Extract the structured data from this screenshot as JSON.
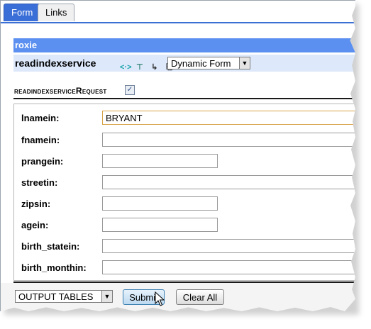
{
  "tabs": [
    {
      "label": "Form",
      "active": true
    },
    {
      "label": "Links",
      "active": false
    }
  ],
  "header": {
    "title": "roxie",
    "service": "readindexservice",
    "service_icons": [
      "xml-view-icon",
      "tree-icon",
      "link-icon",
      "flow-icon"
    ],
    "form_type": {
      "selected": "Dynamic Form"
    }
  },
  "request": {
    "label": "readindexserviceRequest",
    "checked": true
  },
  "fields": [
    {
      "label": "lnamein:",
      "value": "BRYANT",
      "width": "full"
    },
    {
      "label": "fnamein:",
      "value": "",
      "width": "full"
    },
    {
      "label": "prangein:",
      "value": "",
      "width": "short"
    },
    {
      "label": "streetin:",
      "value": "",
      "width": "full"
    },
    {
      "label": "zipsin:",
      "value": "",
      "width": "short"
    },
    {
      "label": "agein:",
      "value": "",
      "width": "short"
    },
    {
      "label": "birth_statein:",
      "value": "",
      "width": "full"
    },
    {
      "label": "birth_monthin:",
      "value": "",
      "width": "full"
    }
  ],
  "footer": {
    "output_select": {
      "selected": "OUTPUT TABLES"
    },
    "submit_label": "Submit",
    "clear_label": "Clear All"
  },
  "colors": {
    "tab_active": "#3b6fd8",
    "roxie_bar": "#5b8ff0",
    "service_bar": "#dde9fb"
  }
}
